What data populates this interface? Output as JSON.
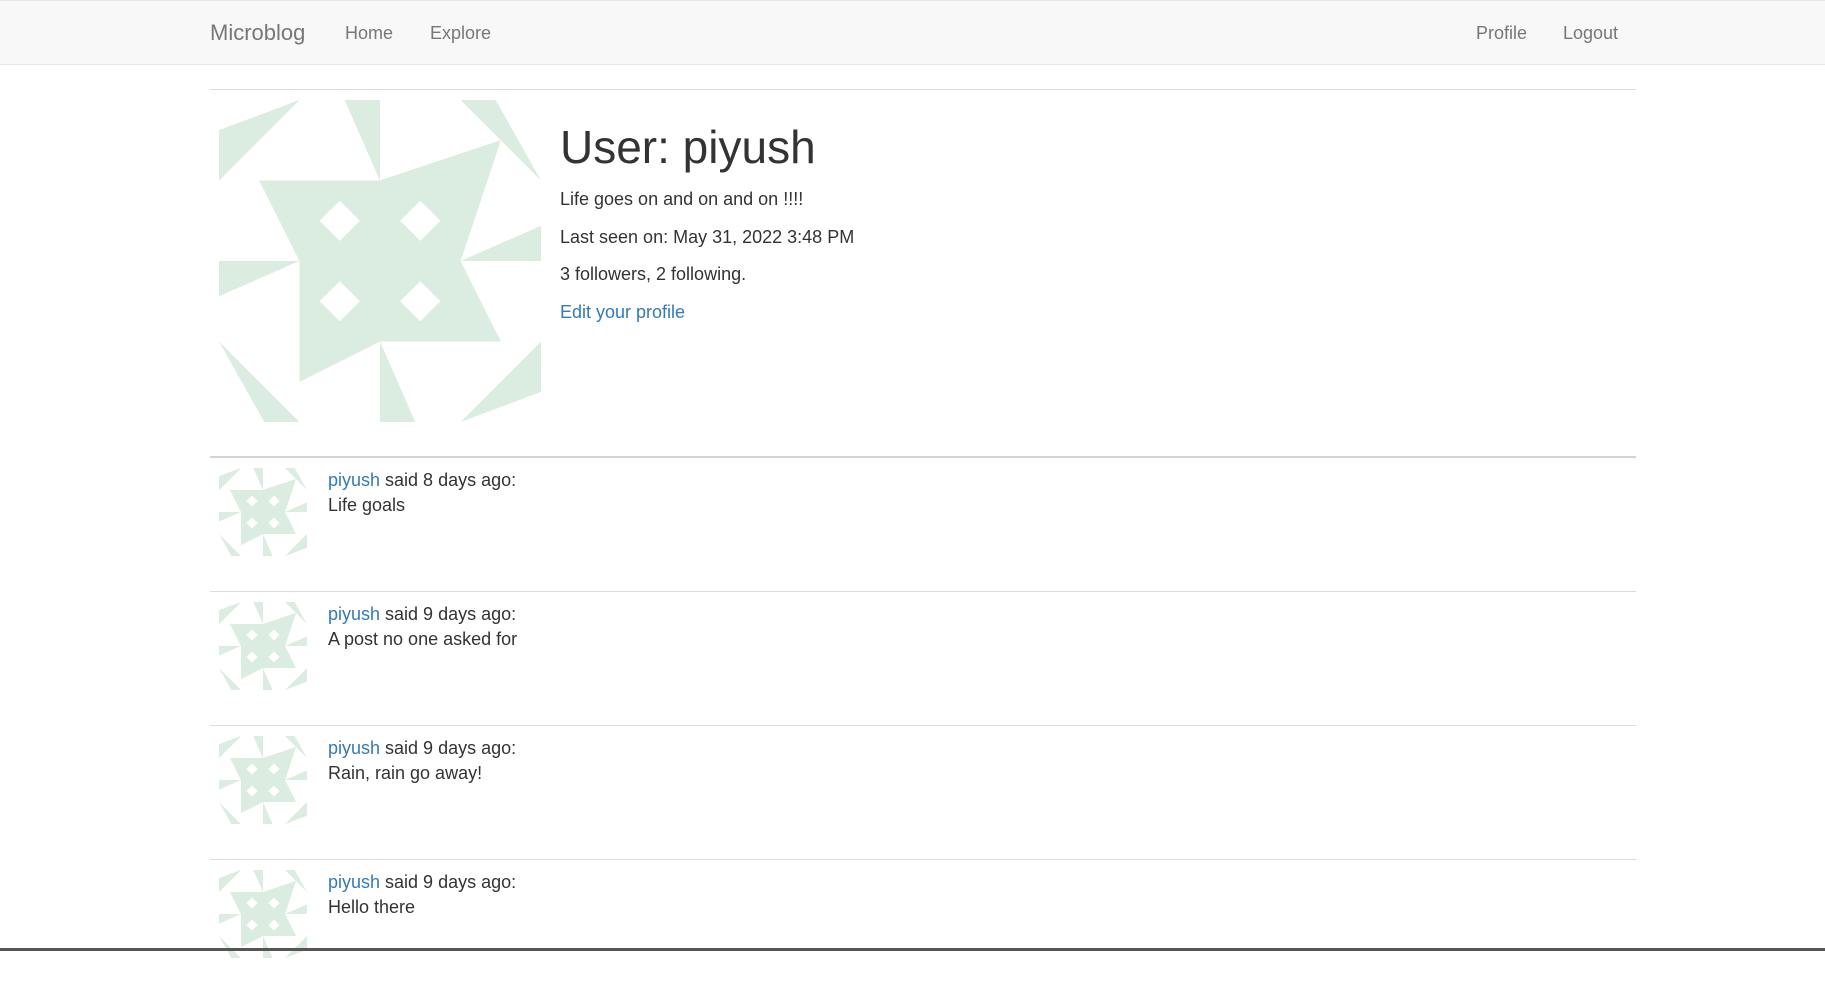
{
  "navbar": {
    "brand": "Microblog",
    "home": "Home",
    "explore": "Explore",
    "profile": "Profile",
    "logout": "Logout"
  },
  "profile": {
    "title": "User: piyush",
    "about": "Life goes on and on and on !!!!",
    "last_seen": "Last seen on: May 31, 2022 3:48 PM",
    "follow_counts": "3 followers, 2 following.",
    "edit_link": "Edit your profile",
    "avatar_color": "#dbede0"
  },
  "posts": [
    {
      "author": "piyush",
      "said": " said 8 days ago:",
      "body": "Life goals"
    },
    {
      "author": "piyush",
      "said": " said 9 days ago:",
      "body": "A post no one asked for"
    },
    {
      "author": "piyush",
      "said": " said 9 days ago:",
      "body": "Rain, rain go away!"
    },
    {
      "author": "piyush",
      "said": " said 9 days ago:",
      "body": "Hello there"
    }
  ],
  "colors": {
    "link": "#337ab7",
    "navbar_bg": "#f8f8f8",
    "nav_text": "#777777"
  }
}
